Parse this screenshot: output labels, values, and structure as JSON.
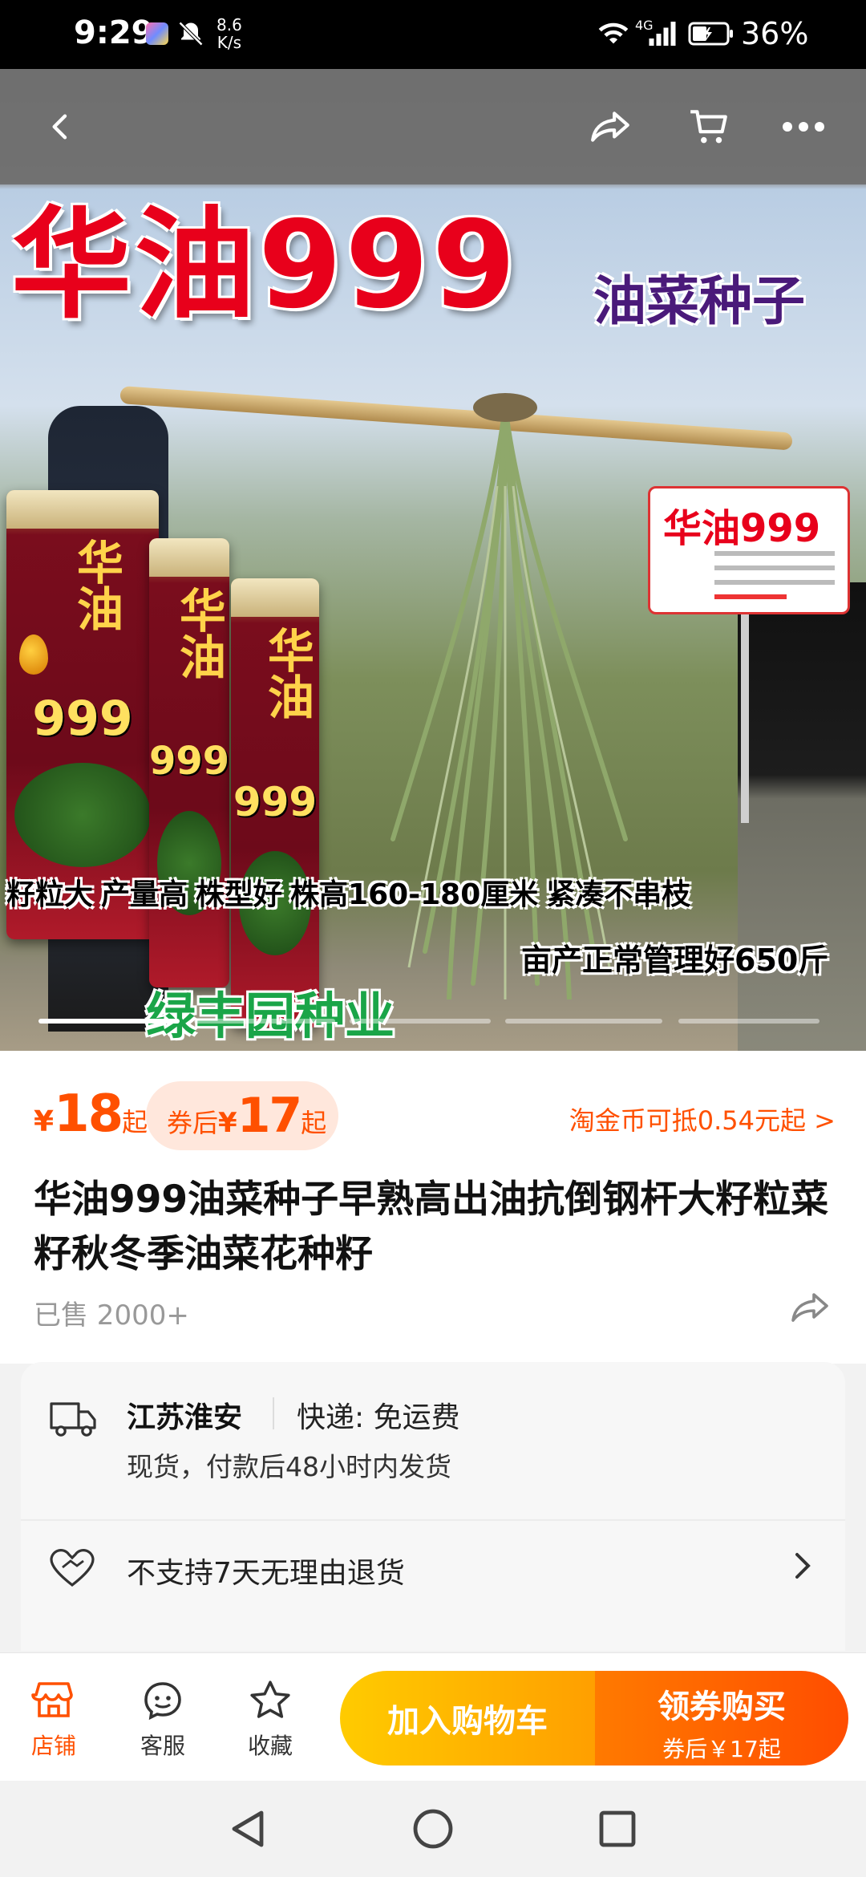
{
  "status_bar": {
    "time": "9:29",
    "speed_value": "8.6",
    "speed_unit": "K/s",
    "network": "4G",
    "battery": "36%"
  },
  "top_nav": {
    "back_icon": "back-arrow-icon",
    "share_icon": "share-icon",
    "cart_icon": "cart-icon",
    "more_icon": "more-icon"
  },
  "hero": {
    "headline": "华油999",
    "subheadline": "油菜种子",
    "package_brand": "华油",
    "package_number": "999",
    "sign_title": "华油999",
    "features": [
      "籽粒大",
      "产量高",
      "株型好",
      "株高160-180厘米",
      "紧凑不串枝"
    ],
    "yield_note": "亩产正常管理好650斤",
    "brand": "绿丰园种业",
    "image_count": 5,
    "active_image": 1
  },
  "price": {
    "currency": "¥",
    "value": "18",
    "suffix": "起",
    "coupon_label": "券后",
    "coupon_value": "17",
    "coupon_suffix": "起",
    "taojin": "淘金币可抵0.54元起 >"
  },
  "product": {
    "title": "华油999油菜种子早熟高出油抗倒钢杆大籽粒菜籽秋冬季油菜花种籽",
    "sold": "已售 2000+"
  },
  "delivery": {
    "origin": "江苏淮安",
    "express": "快递: 免运费",
    "ship_note": "现货，付款后48小时内发货",
    "return_policy": "不支持7天无理由退货"
  },
  "action_bar": {
    "store": "店铺",
    "service": "客服",
    "favorite": "收藏",
    "add_cart": "加入购物车",
    "buy": "领券购买",
    "buy_sub": "券后￥17起"
  },
  "colors": {
    "accent": "#ff5000",
    "cart_button": "#ffb300",
    "buy_button": "#ff5a00"
  }
}
